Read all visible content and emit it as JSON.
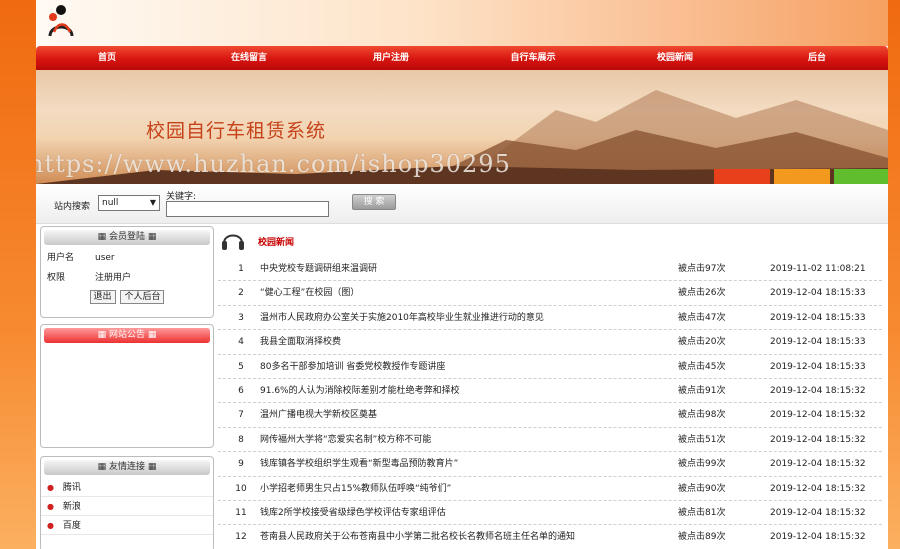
{
  "nav": [
    "首页",
    "在线留言",
    "用户注册",
    "自行车展示",
    "校园新闻",
    "后台"
  ],
  "banner": {
    "title": "校园自行车租赁系统",
    "watermark": "https://www.huzhan.com/ishop30295",
    "stripe_colors": [
      "#e8401a",
      "#f39a1e",
      "#5fbd2e"
    ]
  },
  "search": {
    "label": "站内搜索",
    "select_value": "null",
    "keyword_label": "关键字:",
    "keyword_value": "",
    "button": "搜  索"
  },
  "member": {
    "title": "会员登陆",
    "username_label": "用户名",
    "username_value": "user",
    "role_label": "权限",
    "role_value": "注册用户",
    "logout": "退出",
    "backend": "个人后台"
  },
  "announcement": {
    "title": "网站公告"
  },
  "links": {
    "title": "友情连接",
    "items": [
      "腾讯",
      "新浪",
      "百度"
    ]
  },
  "news": {
    "title": "校园新闻",
    "rows": [
      {
        "no": "1",
        "title": "中央党校专题调研组来温调研",
        "clicks": "被点击97次",
        "date": "2019-11-02 11:08:21"
      },
      {
        "no": "2",
        "title": "“健心工程”在校园（图）",
        "clicks": "被点击26次",
        "date": "2019-12-04 18:15:33"
      },
      {
        "no": "3",
        "title": "温州市人民政府办公室关于实施2010年高校毕业生就业推进行动的意见",
        "clicks": "被点击47次",
        "date": "2019-12-04 18:15:33"
      },
      {
        "no": "4",
        "title": "我县全面取消择校费",
        "clicks": "被点击20次",
        "date": "2019-12-04 18:15:33"
      },
      {
        "no": "5",
        "title": "80多名干部参加培训 省委党校教授作专题讲座",
        "clicks": "被点击45次",
        "date": "2019-12-04 18:15:33"
      },
      {
        "no": "6",
        "title": "91.6%的人认为消除校际差别才能杜绝考弊和择校",
        "clicks": "被点击91次",
        "date": "2019-12-04 18:15:32"
      },
      {
        "no": "7",
        "title": "温州广播电视大学新校区奠基",
        "clicks": "被点击98次",
        "date": "2019-12-04 18:15:32"
      },
      {
        "no": "8",
        "title": "网传福州大学将“恋爱实名制”校方称不可能",
        "clicks": "被点击51次",
        "date": "2019-12-04 18:15:32"
      },
      {
        "no": "9",
        "title": "钱库镇各学校组织学生观看“新型毒品预防教育片”",
        "clicks": "被点击99次",
        "date": "2019-12-04 18:15:32"
      },
      {
        "no": "10",
        "title": "小学招老师男生只占15%教师队伍呼唤“纯爷们”",
        "clicks": "被点击90次",
        "date": "2019-12-04 18:15:32"
      },
      {
        "no": "11",
        "title": "钱库2所学校接受省级绿色学校评估专家组评估",
        "clicks": "被点击81次",
        "date": "2019-12-04 18:15:32"
      },
      {
        "no": "12",
        "title": "苍南县人民政府关于公布苍南县中小学第二批名校长名教师名班主任名单的通知",
        "clicks": "被点击89次",
        "date": "2019-12-04 18:15:32"
      }
    ]
  }
}
